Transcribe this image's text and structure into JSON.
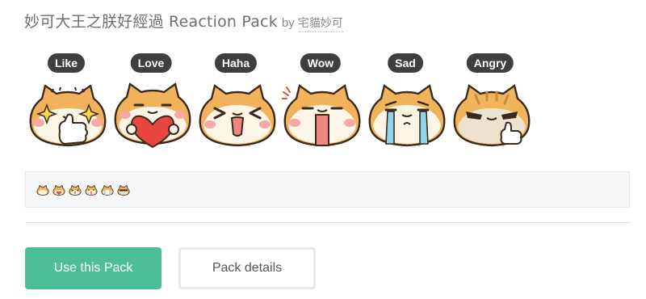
{
  "header": {
    "title": "妙可大王之朕好經過 Reaction Pack",
    "by_label": "by",
    "author": "宅貓妙可"
  },
  "reactions": [
    {
      "label": "Like",
      "icon": "cat-thumbs-up-sparkle-icon"
    },
    {
      "label": "Love",
      "icon": "cat-holding-heart-icon"
    },
    {
      "label": "Haha",
      "icon": "cat-laughing-icon"
    },
    {
      "label": "Wow",
      "icon": "cat-surprised-icon"
    },
    {
      "label": "Sad",
      "icon": "cat-crying-icon"
    },
    {
      "label": "Angry",
      "icon": "cat-angry-thumbs-icon"
    }
  ],
  "colors": {
    "cat_orange": "#f2b25c",
    "cat_cream": "#fdf6e6",
    "cat_outline": "#3a2a1c",
    "blush": "#f7a8a4",
    "primary_button": "#4cbf98",
    "label_pill": "#3f3f3f"
  },
  "buttons": {
    "use_pack": "Use this Pack",
    "pack_details": "Pack details"
  }
}
